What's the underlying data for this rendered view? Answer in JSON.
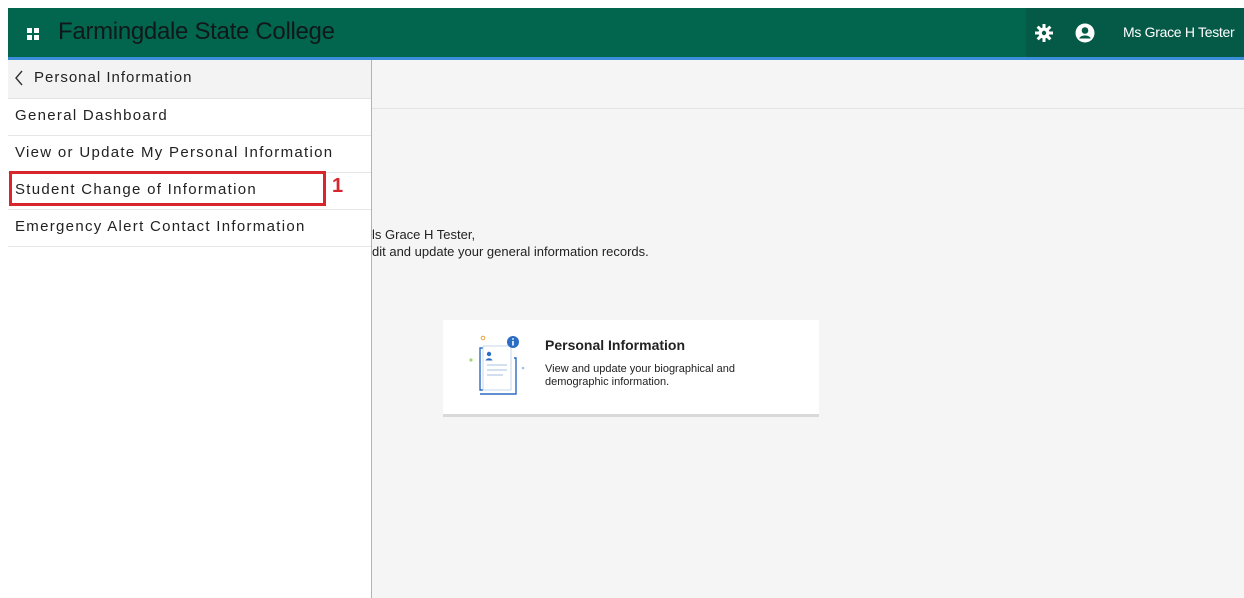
{
  "header": {
    "brand": "Farmingdale State College",
    "user_name": "Ms Grace H Tester"
  },
  "sidebar": {
    "back_label": "Personal Information",
    "items": [
      {
        "label": "General Dashboard"
      },
      {
        "label": "View or Update My Personal Information"
      },
      {
        "label": "Student Change of Information"
      },
      {
        "label": "Emergency Alert Contact Information"
      }
    ],
    "callout": "1"
  },
  "main": {
    "greeting": "ls Grace H Tester,",
    "greeting_sub": "dit and update your general information records.",
    "card": {
      "title": "Personal Information",
      "description": "View and update your biographical and demographic information."
    }
  },
  "colors": {
    "header_bg": "#02664f",
    "accent_blue": "#3a8fd8",
    "highlight_red": "#d9262e"
  }
}
